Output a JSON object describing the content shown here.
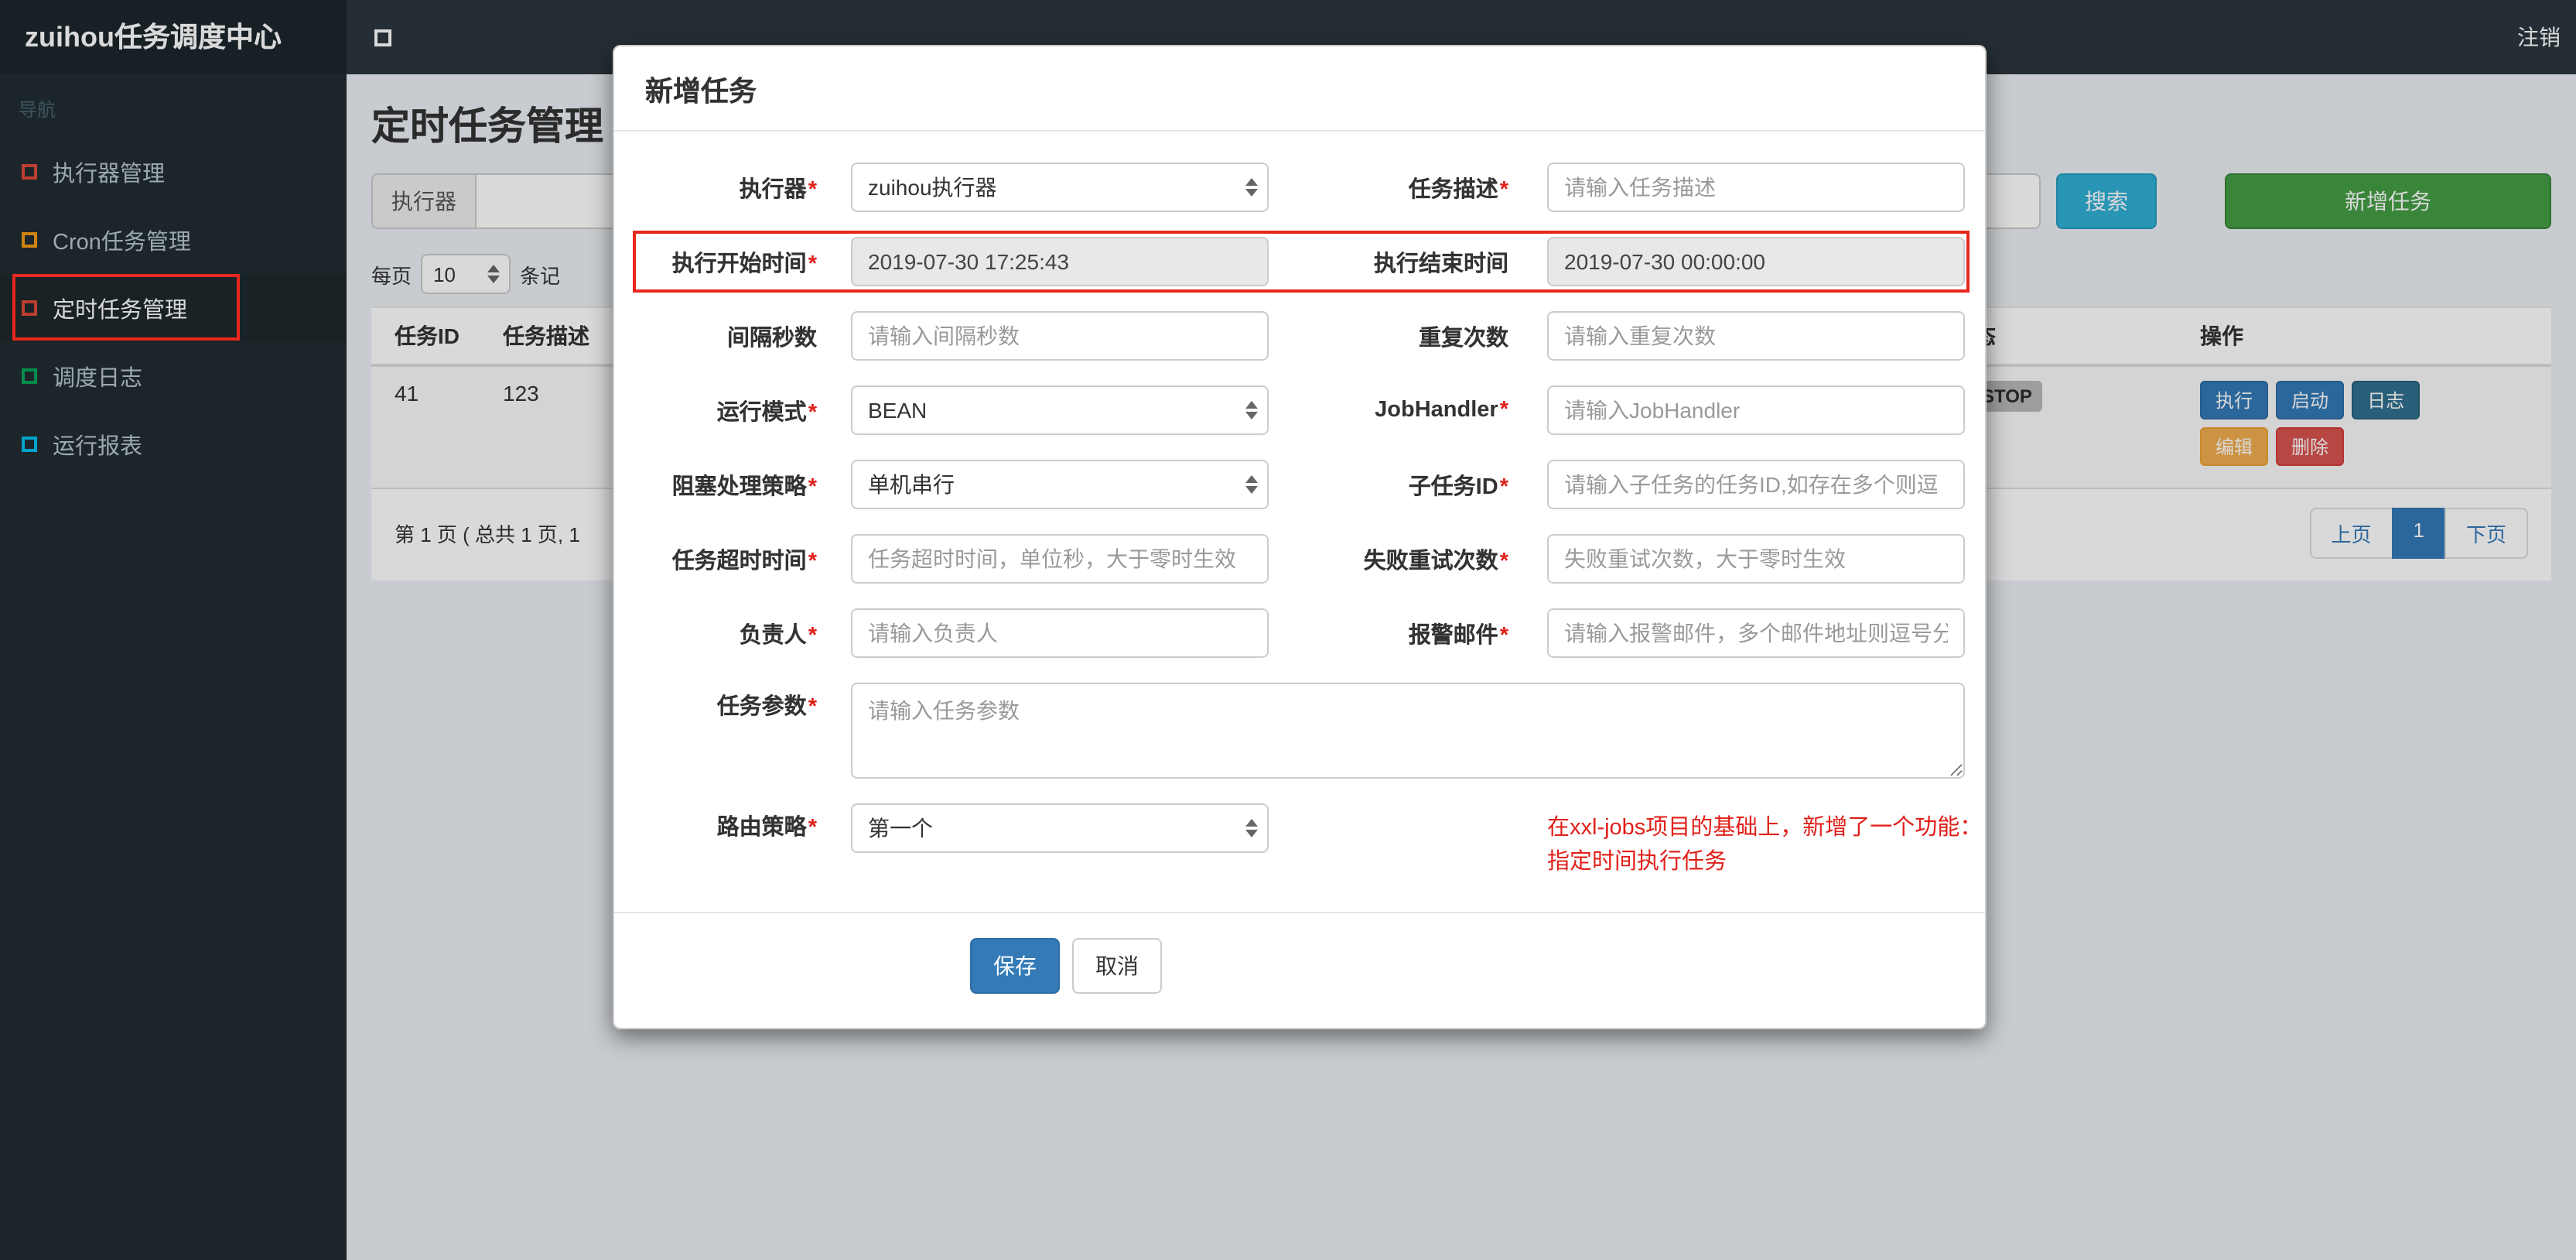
{
  "navbar": {
    "brand": "zuihou任务调度中心",
    "logout": "注销"
  },
  "sidebar": {
    "section_header": "导航",
    "items": [
      {
        "label": "执行器管理"
      },
      {
        "label": "Cron任务管理"
      },
      {
        "label": "定时任务管理"
      },
      {
        "label": "调度日志"
      },
      {
        "label": "运行报表"
      }
    ]
  },
  "page": {
    "title": "定时任务管理",
    "filters": {
      "executor_label": "执行器",
      "search_button": "搜索",
      "add_task_button": "新增任务"
    },
    "per_page": {
      "prefix": "每页",
      "value": "10",
      "suffix": "条记"
    },
    "table": {
      "headers": {
        "task_id": "任务ID",
        "task_desc": "任务描述",
        "status": "状态",
        "actions": "操作"
      },
      "row": {
        "task_id": "41",
        "task_desc": "123",
        "status": "STOP",
        "actions": {
          "execute": "执行",
          "start": "启动",
          "log": "日志",
          "edit": "编辑",
          "delete": "删除"
        }
      }
    },
    "pagination": {
      "summary": "第 1 页 ( 总共 1 页, 1",
      "prev": "上页",
      "page1": "1",
      "next": "下页"
    }
  },
  "modal": {
    "title": "新增任务",
    "required_mark": "*",
    "form": {
      "executor": {
        "label": "执行器",
        "value": "zuihou执行器"
      },
      "task_desc": {
        "label": "任务描述",
        "placeholder": "请输入任务描述"
      },
      "start_time": {
        "label": "执行开始时间",
        "value": "2019-07-30 17:25:43"
      },
      "end_time": {
        "label": "执行结束时间",
        "value": "2019-07-30 00:00:00"
      },
      "interval": {
        "label": "间隔秒数",
        "placeholder": "请输入间隔秒数"
      },
      "repeat": {
        "label": "重复次数",
        "placeholder": "请输入重复次数"
      },
      "run_mode": {
        "label": "运行模式",
        "value": "BEAN"
      },
      "job_handler": {
        "label": "JobHandler",
        "placeholder": "请输入JobHandler"
      },
      "block_strategy": {
        "label": "阻塞处理策略",
        "value": "单机串行"
      },
      "child_job": {
        "label": "子任务ID",
        "placeholder": "请输入子任务的任务ID,如存在多个则逗"
      },
      "timeout": {
        "label": "任务超时时间",
        "placeholder": "任务超时时间，单位秒，大于零时生效"
      },
      "retry": {
        "label": "失败重试次数",
        "placeholder": "失败重试次数，大于零时生效"
      },
      "owner": {
        "label": "负责人",
        "placeholder": "请输入负责人"
      },
      "alarm_email": {
        "label": "报警邮件",
        "placeholder": "请输入报警邮件，多个邮件地址则逗号分"
      },
      "job_param": {
        "label": "任务参数",
        "placeholder": "请输入任务参数"
      },
      "route_strategy": {
        "label": "路由策略",
        "value": "第一个"
      }
    },
    "note_line1": "在xxl-jobs项目的基础上，新增了一个功能：",
    "note_line2": "指定时间执行任务",
    "save_button": "保存",
    "cancel_button": "取消"
  }
}
